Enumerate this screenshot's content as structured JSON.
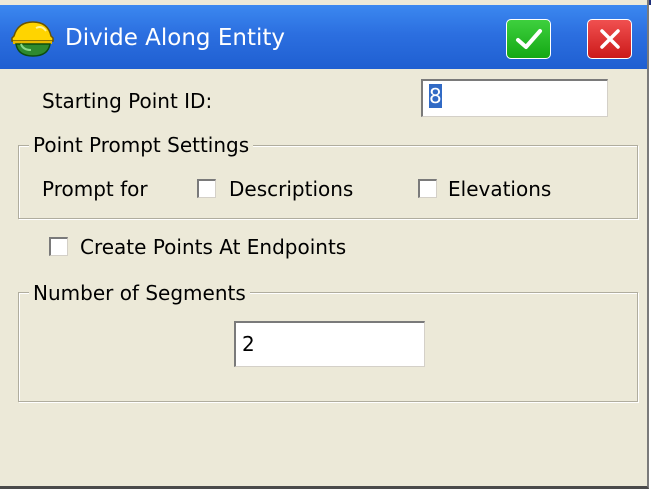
{
  "window": {
    "title": "Divide Along Entity",
    "ok_icon": "checkmark-icon",
    "close_icon": "close-icon",
    "app_icon": "surveyor-hardhat-icon",
    "titlebar_color": "#2c6fe0",
    "ok_color": "#1fb21f",
    "close_color": "#dd2222",
    "background": "#ece9d8"
  },
  "starting_point": {
    "label": "Starting Point ID:",
    "value": "8"
  },
  "point_prompt_settings": {
    "title": "Point Prompt Settings",
    "prompt_label": "Prompt for",
    "descriptions_label": "Descriptions",
    "descriptions_checked": false,
    "elevations_label": "Elevations",
    "elevations_checked": false
  },
  "create_points_at_endpoints": {
    "label": "Create Points At Endpoints",
    "checked": false
  },
  "segments": {
    "title": "Number of Segments",
    "value": "2"
  }
}
